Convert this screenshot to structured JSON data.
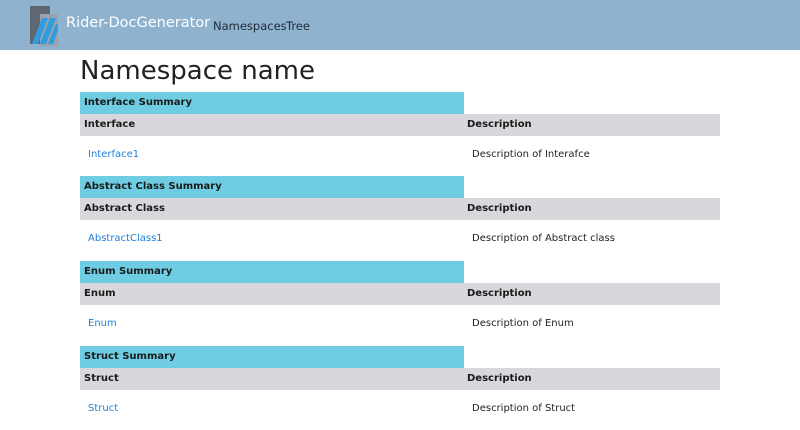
{
  "header": {
    "brand": "Rider-DocGenerator",
    "nav": [
      {
        "label": "Namespaces"
      },
      {
        "label": "Tree"
      }
    ],
    "colors": {
      "bar": "#8fb2cf",
      "logo_accent": "#3aa0d8"
    }
  },
  "main": {
    "title": "Namespace name",
    "sections": [
      {
        "caption": "Interface Summary",
        "col1": "Interface",
        "col2": "Description",
        "rows": [
          {
            "name": "Interface1",
            "description": "Description of Interafce"
          }
        ]
      },
      {
        "caption": "Abstract Class Summary",
        "col1": "Abstract Class",
        "col2": "Description",
        "rows": [
          {
            "name": "AbstractClass1",
            "description": "Description of Abstract class"
          }
        ]
      },
      {
        "caption": "Enum Summary",
        "col1": "Enum",
        "col2": "Description",
        "rows": [
          {
            "name": "Enum",
            "description": "Description of Enum"
          }
        ]
      },
      {
        "caption": "Struct Summary",
        "col1": "Struct",
        "col2": "Description",
        "rows": [
          {
            "name": "Struct",
            "description": "Description of Struct"
          }
        ]
      }
    ],
    "colors": {
      "caption_bg": "#6ecde2",
      "header_bg": "#d8d8dc",
      "link": "#1f7fd8"
    }
  }
}
